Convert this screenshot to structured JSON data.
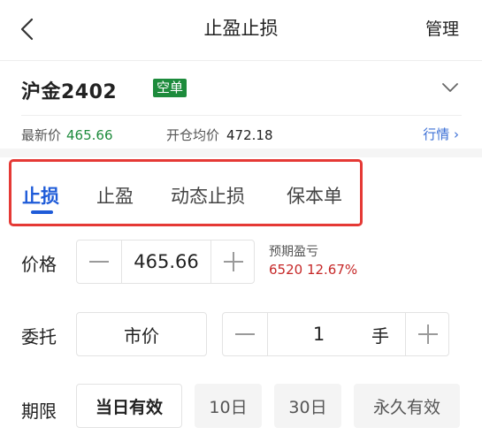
{
  "nav": {
    "title": "止盈止损",
    "manage_label": "管理"
  },
  "contract": {
    "name": "沪金2402",
    "direction_badge": "空单",
    "latest_price_label": "最新价",
    "latest_price": "465.66",
    "avg_open_label": "开仓均价",
    "avg_open_price": "472.18",
    "quote_link": "行情 ›"
  },
  "tabs": [
    {
      "label": "止损",
      "active": true
    },
    {
      "label": "止盈",
      "active": false
    },
    {
      "label": "动态止损",
      "active": false
    },
    {
      "label": "保本单",
      "active": false
    }
  ],
  "price_row": {
    "label": "价格",
    "value": "465.66",
    "pnl_label": "预期盈亏",
    "pnl_value": "6520 12.67%"
  },
  "order_row": {
    "label": "委托",
    "type": "市价",
    "quantity": "1",
    "unit": "手"
  },
  "validity_row": {
    "label": "期限",
    "options": [
      {
        "label": "当日有效",
        "selected": true
      },
      {
        "label": "10日",
        "selected": false
      },
      {
        "label": "30日",
        "selected": false
      },
      {
        "label": "永久有效",
        "selected": false
      }
    ]
  },
  "colors": {
    "accent_blue": "#1e5bd8",
    "green": "#1d8b3c",
    "loss_red": "#c62828",
    "highlight_red": "#e53935"
  }
}
